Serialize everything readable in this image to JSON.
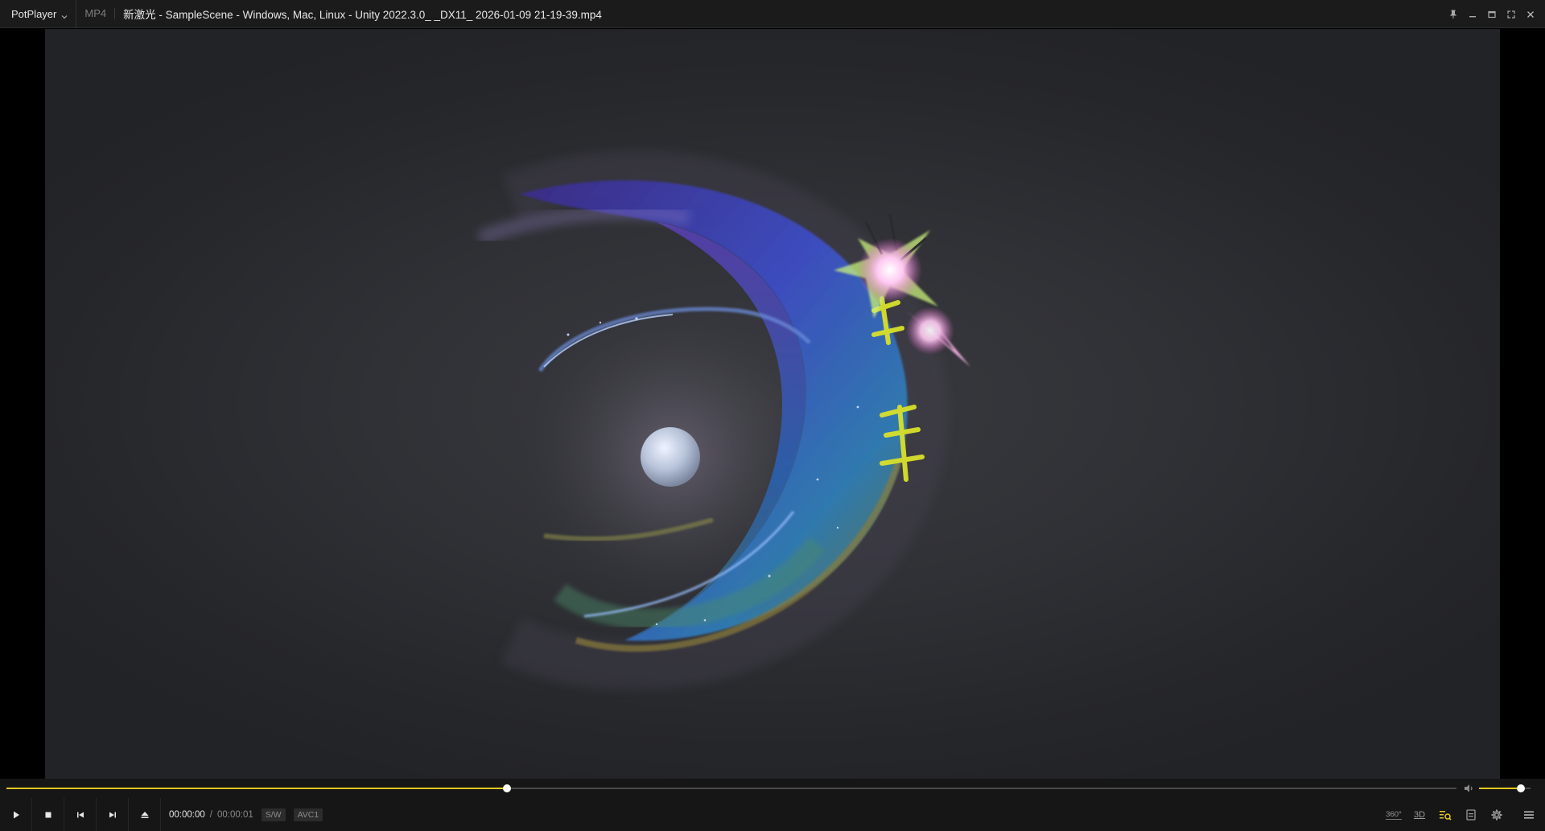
{
  "titlebar": {
    "app_name": "PotPlayer",
    "format": "MP4",
    "title": "新激光 - SampleScene - Windows, Mac, Linux - Unity 2022.3.0_ _DX11_ 2026-01-09 21-19-39.mp4",
    "icons": [
      "pin-icon",
      "minimize-icon",
      "maximize-icon",
      "fullscreen-icon",
      "close-icon"
    ]
  },
  "playback": {
    "current_time": "00:00:00",
    "separator": "/",
    "duration": "00:00:01",
    "decoder_badge": "S/W",
    "codec_badge": "AVC1",
    "progress_fraction": 0.345,
    "volume_fraction": 0.82
  },
  "right_controls": {
    "vr_label": "360°",
    "stereo_label": "3D"
  },
  "colors": {
    "accent": "#e4c720",
    "bar_bg": "#161616",
    "title_bg": "#1b1b1b"
  }
}
